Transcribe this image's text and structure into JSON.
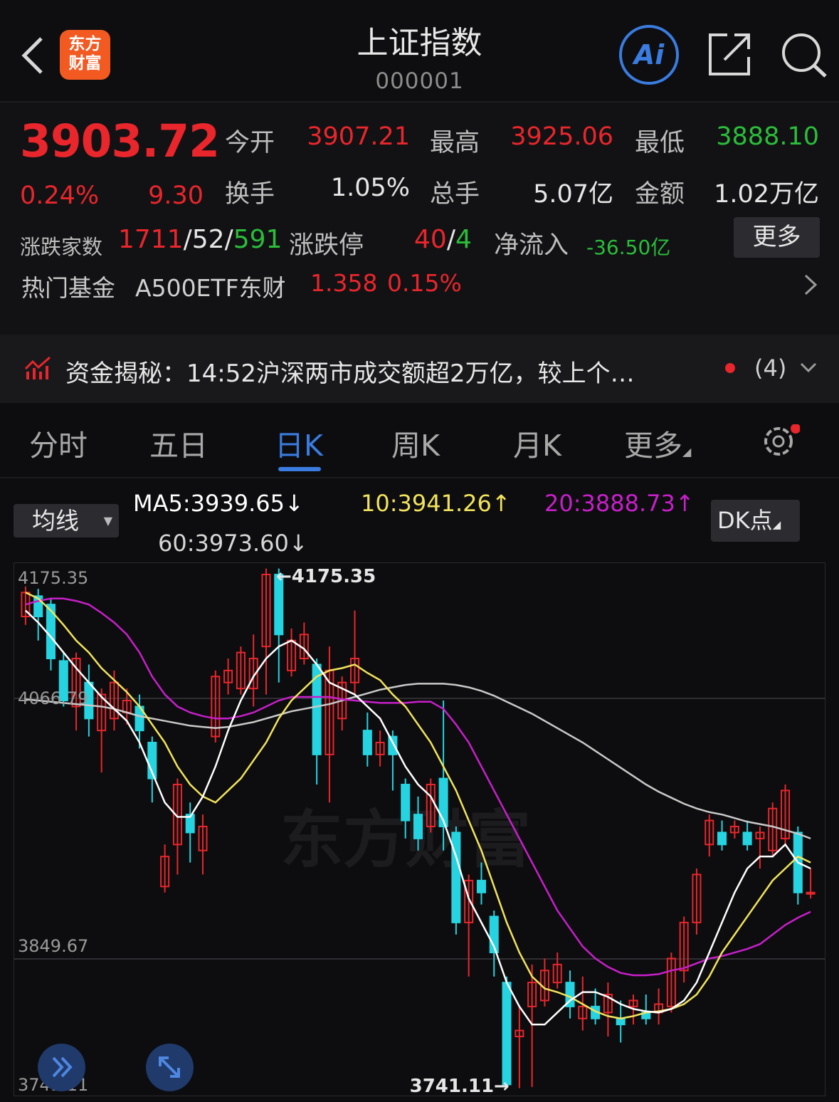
{
  "header": {
    "title": "上证指数",
    "code": "000001",
    "logo_line1": "东方",
    "logo_line2": "财富",
    "ai_label": "Ai"
  },
  "quote": {
    "price": "3903.72",
    "change_pct": "0.24%",
    "change": "9.30",
    "open_label": "今开",
    "open": "3907.21",
    "high_label": "最高",
    "high": "3925.06",
    "low_label": "最低",
    "low": "3888.10",
    "turnover_label": "换手",
    "turnover": "1.05%",
    "volume_label": "总手",
    "volume": "5.07亿",
    "amount_label": "金额",
    "amount": "1.02万亿",
    "breadth_label": "涨跌家数",
    "breadth_up": "1711",
    "breadth_flat": "52",
    "breadth_down": "591",
    "limit_label": "涨跌停",
    "limit_up": "40",
    "limit_down": "4",
    "netflow_label": "净流入",
    "netflow": "-36.50亿",
    "more_label": "更多"
  },
  "fund": {
    "label": "热门基金",
    "name": "A500ETF东财",
    "price": "1.358",
    "pct": "0.15%"
  },
  "news": {
    "text": "资金揭秘：14:52沪深两市成交额超2万亿，较上个…",
    "count": "(4)"
  },
  "tabs": {
    "fenshi": "分时",
    "wuri": "五日",
    "rik": "日K",
    "zhouk": "周K",
    "yuek": "月K",
    "more": "更多"
  },
  "indicators": {
    "select_label": "均线",
    "ma5": "MA5:3939.65↓",
    "ma10": "10:3941.26↑",
    "ma20": "20:3888.73↑",
    "ma60": "60:3973.60↓",
    "dk_label": "DK点",
    "color_ma5": "#ffffff",
    "color_ma10": "#f2e35c",
    "color_ma20": "#c71fc9",
    "color_ma60": "#c9c9c9",
    "color_up": "#e8262b",
    "color_down": "#25d4e0"
  },
  "chart_data": {
    "type": "candlestick",
    "y_labels": [
      "4175.35",
      "4066.79",
      "3849.67",
      "3741.11"
    ],
    "ylim": [
      3741.11,
      4175.35
    ],
    "high_annotation": "←4175.35",
    "low_annotation": "3741.11→",
    "watermark": "东方财富",
    "candles": [
      {
        "o": 4135,
        "c": 4155,
        "h": 4160,
        "l": 4128
      },
      {
        "o": 4152,
        "c": 4135,
        "h": 4158,
        "l": 4115
      },
      {
        "o": 4145,
        "c": 4100,
        "h": 4150,
        "l": 4090
      },
      {
        "o": 4098,
        "c": 4065,
        "h": 4105,
        "l": 4060
      },
      {
        "o": 4060,
        "c": 4100,
        "h": 4105,
        "l": 4040
      },
      {
        "o": 4080,
        "c": 4050,
        "h": 4095,
        "l": 4035
      },
      {
        "o": 4040,
        "c": 4070,
        "h": 4075,
        "l": 4005
      },
      {
        "o": 4050,
        "c": 4080,
        "h": 4090,
        "l": 4040
      },
      {
        "o": 4055,
        "c": 4065,
        "h": 4075,
        "l": 4045
      },
      {
        "o": 4060,
        "c": 4040,
        "h": 4070,
        "l": 4025
      },
      {
        "o": 4030,
        "c": 4000,
        "h": 4035,
        "l": 3980
      },
      {
        "o": 3910,
        "c": 3935,
        "h": 3945,
        "l": 3905
      },
      {
        "o": 3945,
        "c": 3995,
        "h": 4000,
        "l": 3920
      },
      {
        "o": 3970,
        "c": 3955,
        "h": 3980,
        "l": 3930
      },
      {
        "o": 3940,
        "c": 3960,
        "h": 3970,
        "l": 3920
      },
      {
        "o": 4035,
        "c": 4085,
        "h": 4090,
        "l": 4030
      },
      {
        "o": 4080,
        "c": 4090,
        "h": 4100,
        "l": 4070
      },
      {
        "o": 4075,
        "c": 4105,
        "h": 4110,
        "l": 4070
      },
      {
        "o": 4075,
        "c": 4100,
        "h": 4120,
        "l": 4060
      },
      {
        "o": 4110,
        "c": 4170,
        "h": 4175,
        "l": 4070
      },
      {
        "o": 4170,
        "c": 4120,
        "h": 4175,
        "l": 4080
      },
      {
        "o": 4090,
        "c": 4115,
        "h": 4125,
        "l": 4085
      },
      {
        "o": 4100,
        "c": 4120,
        "h": 4130,
        "l": 4095
      },
      {
        "o": 4095,
        "c": 4020,
        "h": 4100,
        "l": 3995
      },
      {
        "o": 4020,
        "c": 4090,
        "h": 4110,
        "l": 3980
      },
      {
        "o": 4050,
        "c": 4080,
        "h": 4085,
        "l": 4040
      },
      {
        "o": 4080,
        "c": 4100,
        "h": 4140,
        "l": 4070
      },
      {
        "o": 4040,
        "c": 4020,
        "h": 4055,
        "l": 4010
      },
      {
        "o": 4020,
        "c": 4030,
        "h": 4040,
        "l": 4010
      },
      {
        "o": 4035,
        "c": 4020,
        "h": 4040,
        "l": 3990
      },
      {
        "o": 3995,
        "c": 3965,
        "h": 4000,
        "l": 3950
      },
      {
        "o": 3970,
        "c": 3950,
        "h": 3985,
        "l": 3940
      },
      {
        "o": 3960,
        "c": 3995,
        "h": 4000,
        "l": 3955
      },
      {
        "o": 4000,
        "c": 3960,
        "h": 4065,
        "l": 3940
      },
      {
        "o": 3955,
        "c": 3880,
        "h": 3960,
        "l": 3870
      },
      {
        "o": 3880,
        "c": 3915,
        "h": 3920,
        "l": 3835
      },
      {
        "o": 3915,
        "c": 3905,
        "h": 3930,
        "l": 3895
      },
      {
        "o": 3885,
        "c": 3855,
        "h": 3890,
        "l": 3835
      },
      {
        "o": 3830,
        "c": 3745,
        "h": 3835,
        "l": 3745
      },
      {
        "o": 3785,
        "c": 3790,
        "h": 3810,
        "l": 3742
      },
      {
        "o": 3810,
        "c": 3830,
        "h": 3845,
        "l": 3743
      },
      {
        "o": 3815,
        "c": 3840,
        "h": 3850,
        "l": 3810
      },
      {
        "o": 3830,
        "c": 3845,
        "h": 3855,
        "l": 3825
      },
      {
        "o": 3830,
        "c": 3810,
        "h": 3840,
        "l": 3800
      },
      {
        "o": 3800,
        "c": 3810,
        "h": 3835,
        "l": 3790
      },
      {
        "o": 3810,
        "c": 3800,
        "h": 3825,
        "l": 3795
      },
      {
        "o": 3805,
        "c": 3820,
        "h": 3830,
        "l": 3785
      },
      {
        "o": 3800,
        "c": 3795,
        "h": 3815,
        "l": 3780
      },
      {
        "o": 3810,
        "c": 3815,
        "h": 3820,
        "l": 3795
      },
      {
        "o": 3805,
        "c": 3800,
        "h": 3820,
        "l": 3795
      },
      {
        "o": 3805,
        "c": 3812,
        "h": 3825,
        "l": 3795
      },
      {
        "o": 3810,
        "c": 3850,
        "h": 3855,
        "l": 3805
      },
      {
        "o": 3840,
        "c": 3880,
        "h": 3885,
        "l": 3830
      },
      {
        "o": 3880,
        "c": 3920,
        "h": 3925,
        "l": 3870
      },
      {
        "o": 3945,
        "c": 3965,
        "h": 3970,
        "l": 3935
      },
      {
        "o": 3955,
        "c": 3945,
        "h": 3965,
        "l": 3940
      },
      {
        "o": 3955,
        "c": 3960,
        "h": 3965,
        "l": 3950
      },
      {
        "o": 3955,
        "c": 3945,
        "h": 3965,
        "l": 3940
      },
      {
        "o": 3950,
        "c": 3955,
        "h": 3960,
        "l": 3925
      },
      {
        "o": 3940,
        "c": 3975,
        "h": 3980,
        "l": 3935
      },
      {
        "o": 3950,
        "c": 3990,
        "h": 3995,
        "l": 3945
      },
      {
        "o": 3955,
        "c": 3905,
        "h": 3960,
        "l": 3895
      },
      {
        "o": 3905,
        "c": 3905,
        "h": 3925,
        "l": 3900
      }
    ],
    "ma5": [
      4140,
      4130,
      4118,
      4105,
      4092,
      4080,
      4068,
      4058,
      4048,
      4030,
      4005,
      3980,
      3968,
      3968,
      3985,
      4010,
      4040,
      4065,
      4085,
      4100,
      4110,
      4115,
      4108,
      4095,
      4080,
      4075,
      4070,
      4060,
      4050,
      4030,
      4010,
      3995,
      3985,
      3965,
      3935,
      3900,
      3880,
      3860,
      3830,
      3810,
      3795,
      3795,
      3805,
      3815,
      3822,
      3822,
      3818,
      3812,
      3808,
      3806,
      3805,
      3808,
      3815,
      3830,
      3855,
      3880,
      3905,
      3925,
      3935,
      3935,
      3945,
      3930,
      3925
    ],
    "ma10": [
      4155,
      4150,
      4140,
      4128,
      4115,
      4105,
      4092,
      4082,
      4072,
      4060,
      4045,
      4030,
      4010,
      3995,
      3985,
      3980,
      3990,
      4000,
      4015,
      4030,
      4050,
      4065,
      4075,
      4085,
      4090,
      4092,
      4095,
      4088,
      4082,
      4070,
      4060,
      4045,
      4030,
      4010,
      3990,
      3965,
      3940,
      3910,
      3880,
      3855,
      3835,
      3825,
      3822,
      3818,
      3812,
      3806,
      3802,
      3800,
      3802,
      3805,
      3806,
      3808,
      3812,
      3820,
      3835,
      3855,
      3870,
      3885,
      3900,
      3915,
      3925,
      3935,
      3930
    ],
    "ma20": [
      4145,
      4148,
      4150,
      4150,
      4148,
      4145,
      4138,
      4130,
      4120,
      4105,
      4085,
      4070,
      4060,
      4055,
      4052,
      4050,
      4050,
      4052,
      4055,
      4060,
      4065,
      4068,
      4068,
      4068,
      4068,
      4066,
      4065,
      4064,
      4063,
      4063,
      4063,
      4064,
      4064,
      4058,
      4045,
      4030,
      4010,
      3990,
      3970,
      3950,
      3930,
      3910,
      3890,
      3875,
      3860,
      3850,
      3843,
      3838,
      3836,
      3836,
      3837,
      3840,
      3842,
      3846,
      3850,
      3852,
      3855,
      3858,
      3862,
      3870,
      3878,
      3884,
      3889
    ],
    "ma60": [
      4066,
      4065,
      4064,
      4063,
      4062,
      4061,
      4060,
      4058,
      4055,
      4052,
      4050,
      4048,
      4046,
      4044,
      4043,
      4042,
      4043,
      4045,
      4047,
      4050,
      4053,
      4056,
      4058,
      4060,
      4062,
      4065,
      4068,
      4071,
      4074,
      4076,
      4078,
      4079,
      4079,
      4079,
      4078,
      4076,
      4073,
      4069,
      4064,
      4059,
      4054,
      4048,
      4042,
      4036,
      4030,
      4023,
      4016,
      4009,
      4002,
      3995,
      3989,
      3984,
      3979,
      3975,
      3972,
      3970,
      3967,
      3964,
      3962,
      3960,
      3957,
      3954,
      3950
    ]
  }
}
